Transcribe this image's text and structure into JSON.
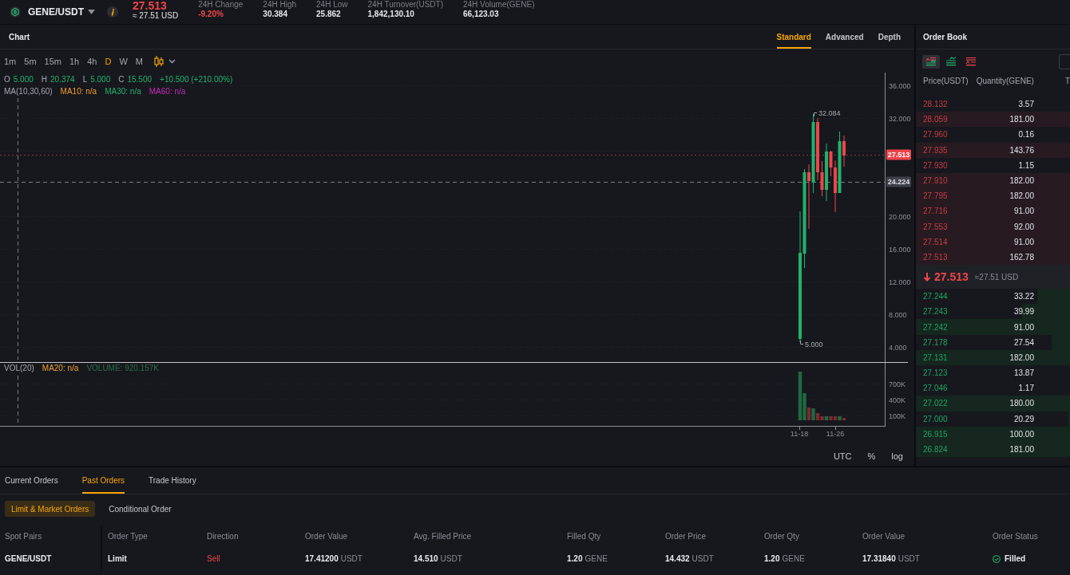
{
  "top_bar": {
    "pair": "GENE/USDT",
    "last_price": {
      "value": "27.513",
      "fiat": "≈ 27.51 USD",
      "falling": true
    },
    "stats": [
      {
        "label": "24H Change",
        "value": "-9.20%",
        "negative": true
      },
      {
        "label": "24H High",
        "value": "30.384",
        "negative": false
      },
      {
        "label": "24H Low",
        "value": "25.862",
        "negative": false
      },
      {
        "label": "24H Turnover(USDT)",
        "value": "1,842,130.10",
        "negative": false
      },
      {
        "label": "24H Volume(GENE)",
        "value": "66,123.03",
        "negative": false
      }
    ]
  },
  "chart_panel": {
    "title": "Chart",
    "view_tabs": [
      {
        "label": "Standard",
        "selected": true
      },
      {
        "label": "Advanced",
        "selected": false
      },
      {
        "label": "Depth",
        "selected": false
      }
    ],
    "intervals": [
      {
        "label": "1m",
        "selected": false
      },
      {
        "label": "5m",
        "selected": false
      },
      {
        "label": "15m",
        "selected": false
      },
      {
        "label": "1h",
        "selected": false
      },
      {
        "label": "4h",
        "selected": false
      },
      {
        "label": "D",
        "selected": true
      },
      {
        "label": "W",
        "selected": false
      },
      {
        "label": "M",
        "selected": false
      }
    ],
    "ohlc": [
      {
        "label": "O",
        "value": "5.000"
      },
      {
        "label": "H",
        "value": "20.374"
      },
      {
        "label": "L",
        "value": "5.000"
      },
      {
        "label": "C",
        "value": "15.500"
      }
    ],
    "change": "+10.500 (+210.00%)",
    "ma_legend": {
      "label": "MA(10,30,60)",
      "items": [
        {
          "text": "MA10: n/a",
          "color": "#f0a030"
        },
        {
          "text": "MA30: n/a",
          "color": "#22b36c"
        },
        {
          "text": "MA60: n/a",
          "color": "#c42bb5"
        }
      ]
    },
    "price_axis": [
      "36.000",
      "32.000",
      "20.000",
      "16.000",
      "12.000",
      "8.000",
      "4.000"
    ],
    "price_tags": [
      {
        "kind": "last",
        "value": "27.513"
      },
      {
        "kind": "crosshair",
        "value": "24.224"
      }
    ],
    "high_marker": "32.084",
    "low_marker": "5.000",
    "volume_legend": {
      "label": "VOL(20)",
      "items": [
        {
          "text": "MA20: n/a",
          "color": "#f0a030"
        },
        {
          "text": "VOLUME: 920.157K",
          "color": "#2b6e47"
        }
      ]
    },
    "volume_axis": [
      "700K",
      "400K",
      "100K"
    ],
    "time_axis": [
      "11-18",
      "11-26"
    ],
    "scale_options": [
      "UTC",
      "%",
      "log"
    ]
  },
  "order_book": {
    "title": "Order Book",
    "views": [
      {
        "kind": "both",
        "selected": true
      },
      {
        "kind": "bids",
        "selected": false
      },
      {
        "kind": "asks",
        "selected": false
      }
    ],
    "columns": [
      "Price(USDT)",
      "Quantity(GENE)",
      "T"
    ],
    "asks": [
      {
        "price": "28.132",
        "quantity": "3.57"
      },
      {
        "price": "28.059",
        "quantity": "181.00",
        "level": 1
      },
      {
        "price": "27.960",
        "quantity": "0.16"
      },
      {
        "price": "27.935",
        "quantity": "143.76",
        "level": 1
      },
      {
        "price": "27.930",
        "quantity": "1.15"
      },
      {
        "price": "27.910",
        "quantity": "182.00",
        "level": 1
      },
      {
        "price": "27.795",
        "quantity": "182.00",
        "level": 1
      },
      {
        "price": "27.716",
        "quantity": "91.00",
        "level": 1
      },
      {
        "price": "27.553",
        "quantity": "92.00",
        "level": 1
      },
      {
        "price": "27.514",
        "quantity": "91.00",
        "level": 1
      },
      {
        "price": "27.513",
        "quantity": "162.78",
        "level": 1
      }
    ],
    "mid_price": {
      "value": "27.513",
      "fiat": "≈27.51 USD",
      "falling": true
    },
    "bids": [
      {
        "price": "27.244",
        "quantity": "33.22",
        "level": 0.21
      },
      {
        "price": "27.243",
        "quantity": "39.99",
        "level": 0.31
      },
      {
        "price": "27.242",
        "quantity": "91.00",
        "level": 1
      },
      {
        "price": "27.178",
        "quantity": "27.54",
        "level": 0.12
      },
      {
        "price": "27.131",
        "quantity": "182.00",
        "level": 1
      },
      {
        "price": "27.123",
        "quantity": "13.87"
      },
      {
        "price": "27.046",
        "quantity": "1.17"
      },
      {
        "price": "27.022",
        "quantity": "180.00",
        "level": 1
      },
      {
        "price": "27.000",
        "quantity": "20.29",
        "level": 0.01
      },
      {
        "price": "26.915",
        "quantity": "100.00",
        "level": 1
      },
      {
        "price": "26.824",
        "quantity": "181.00",
        "level": 1
      }
    ]
  },
  "orders_panel": {
    "tabs": [
      {
        "label": "Current Orders",
        "selected": false
      },
      {
        "label": "Past Orders",
        "selected": true
      },
      {
        "label": "Trade History",
        "selected": false
      }
    ],
    "sub_tabs": [
      {
        "label": "Limit & Market Orders",
        "selected": true
      },
      {
        "label": "Conditional Order",
        "selected": false
      }
    ],
    "columns": [
      "Spot Pairs",
      "Order Type",
      "Direction",
      "Order Value",
      "Avg. Filled Price",
      "Filled Qty",
      "Order Price",
      "Order Qty",
      "Order Value",
      "Order Status"
    ],
    "rows": [
      {
        "cells": [
          {
            "kind": "pair",
            "text": "GENE/USDT"
          },
          {
            "kind": "text",
            "text": "Limit"
          },
          {
            "kind": "side",
            "text": "Sell",
            "sell": true
          },
          {
            "kind": "amount",
            "value": "17.41200",
            "unit": "USDT"
          },
          {
            "kind": "amount",
            "value": "14.510",
            "unit": "USDT"
          },
          {
            "kind": "amount",
            "value": "1.20",
            "unit": "GENE"
          },
          {
            "kind": "amount",
            "value": "14.432",
            "unit": "USDT"
          },
          {
            "kind": "amount",
            "value": "1.20",
            "unit": "GENE"
          },
          {
            "kind": "amount",
            "value": "17.31840",
            "unit": "USDT"
          },
          {
            "kind": "status",
            "text": "Filled",
            "done": true
          }
        ]
      }
    ]
  }
}
